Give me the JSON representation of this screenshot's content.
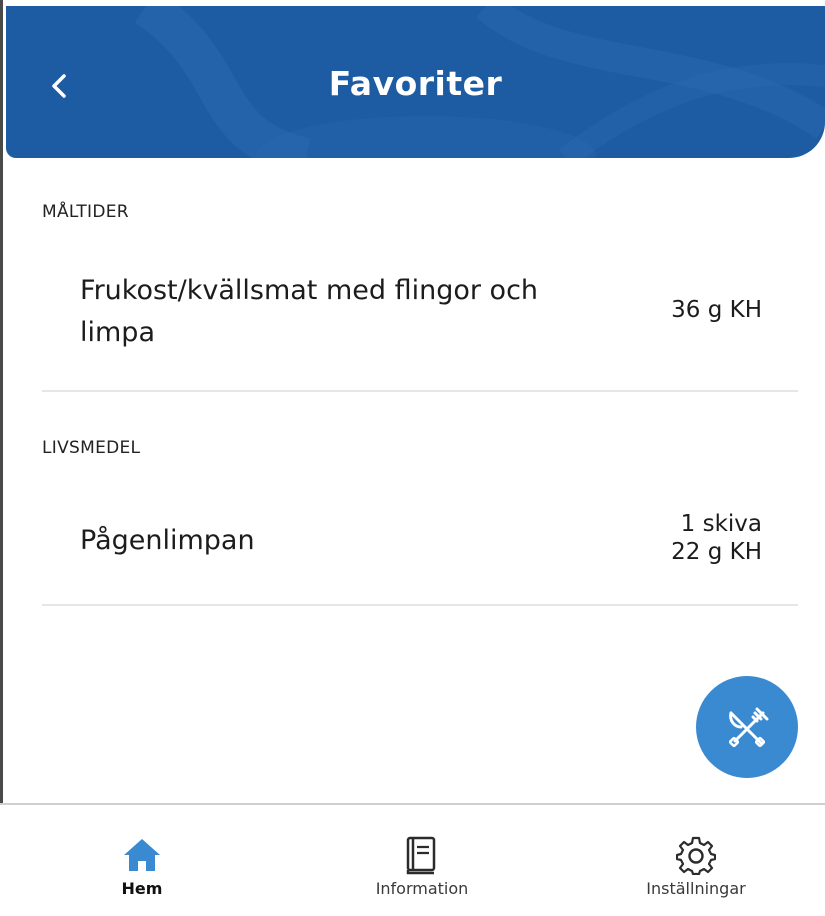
{
  "header": {
    "title": "Favoriter",
    "back_icon": "chevron-left-icon",
    "color": "#1d5ba3"
  },
  "sections": [
    {
      "label": "MÅLTIDER",
      "items": [
        {
          "name_line1": "Frukost/kvällsmat med flingor och",
          "name_line2": "limpa",
          "value_line1": "36 g KH",
          "value_line2": ""
        }
      ]
    },
    {
      "label": "LIVSMEDEL",
      "items": [
        {
          "name_line1": "Pågenlimpan",
          "name_line2": "",
          "value_line1": "1 skiva",
          "value_line2": "22 g KH"
        }
      ]
    }
  ],
  "fab": {
    "icon": "cutlery-icon",
    "color": "#3a8ad2"
  },
  "nav": [
    {
      "label": "Hem",
      "icon": "home-icon",
      "active": true,
      "color": "#3a8ad2"
    },
    {
      "label": "Information",
      "icon": "book-icon",
      "active": false
    },
    {
      "label": "Inställningar",
      "icon": "gear-icon",
      "active": false
    }
  ]
}
